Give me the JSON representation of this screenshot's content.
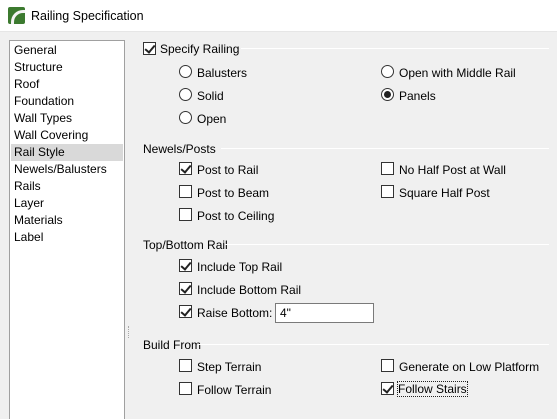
{
  "window": {
    "title": "Railing Specification"
  },
  "sidebar": {
    "items": [
      {
        "label": "General"
      },
      {
        "label": "Structure"
      },
      {
        "label": "Roof"
      },
      {
        "label": "Foundation"
      },
      {
        "label": "Wall Types"
      },
      {
        "label": "Wall Covering"
      },
      {
        "label": "Rail Style",
        "selected": true
      },
      {
        "label": "Newels/Balusters"
      },
      {
        "label": "Rails"
      },
      {
        "label": "Layer"
      },
      {
        "label": "Materials"
      },
      {
        "label": "Label"
      }
    ]
  },
  "specify_railing": {
    "label": "Specify Railing",
    "checked": true,
    "options": [
      {
        "label": "Balusters",
        "selected": false
      },
      {
        "label": "Solid",
        "selected": false
      },
      {
        "label": "Open",
        "selected": false
      },
      {
        "label": "Open with Middle Rail",
        "selected": false
      },
      {
        "label": "Panels",
        "selected": true
      }
    ]
  },
  "newels": {
    "title": "Newels/Posts",
    "post_to_rail": {
      "label": "Post to Rail",
      "checked": true
    },
    "post_to_beam": {
      "label": "Post to Beam",
      "checked": false
    },
    "post_to_ceiling": {
      "label": "Post to Ceiling",
      "checked": false
    },
    "no_half_post": {
      "label": "No Half Post at Wall",
      "checked": false
    },
    "square_half_post": {
      "label": "Square Half Post",
      "checked": false
    }
  },
  "top_bottom_rail": {
    "title": "Top/Bottom Rail",
    "include_top": {
      "label": "Include Top Rail",
      "checked": true
    },
    "include_bottom": {
      "label": "Include Bottom Rail",
      "checked": true
    },
    "raise_bottom": {
      "label": "Raise Bottom:",
      "checked": true,
      "value": "4\""
    }
  },
  "build_from": {
    "title": "Build From",
    "step_terrain": {
      "label": "Step Terrain",
      "checked": false
    },
    "follow_terrain": {
      "label": "Follow Terrain",
      "checked": false
    },
    "generate_low_platform": {
      "label": "Generate on Low Platform",
      "checked": false
    },
    "follow_stairs": {
      "label": "Follow Stairs",
      "checked": true
    }
  },
  "colors": {
    "selection": "#d9d9d9",
    "background": "#f0f0f0",
    "app_icon": "#3c7a2f"
  }
}
